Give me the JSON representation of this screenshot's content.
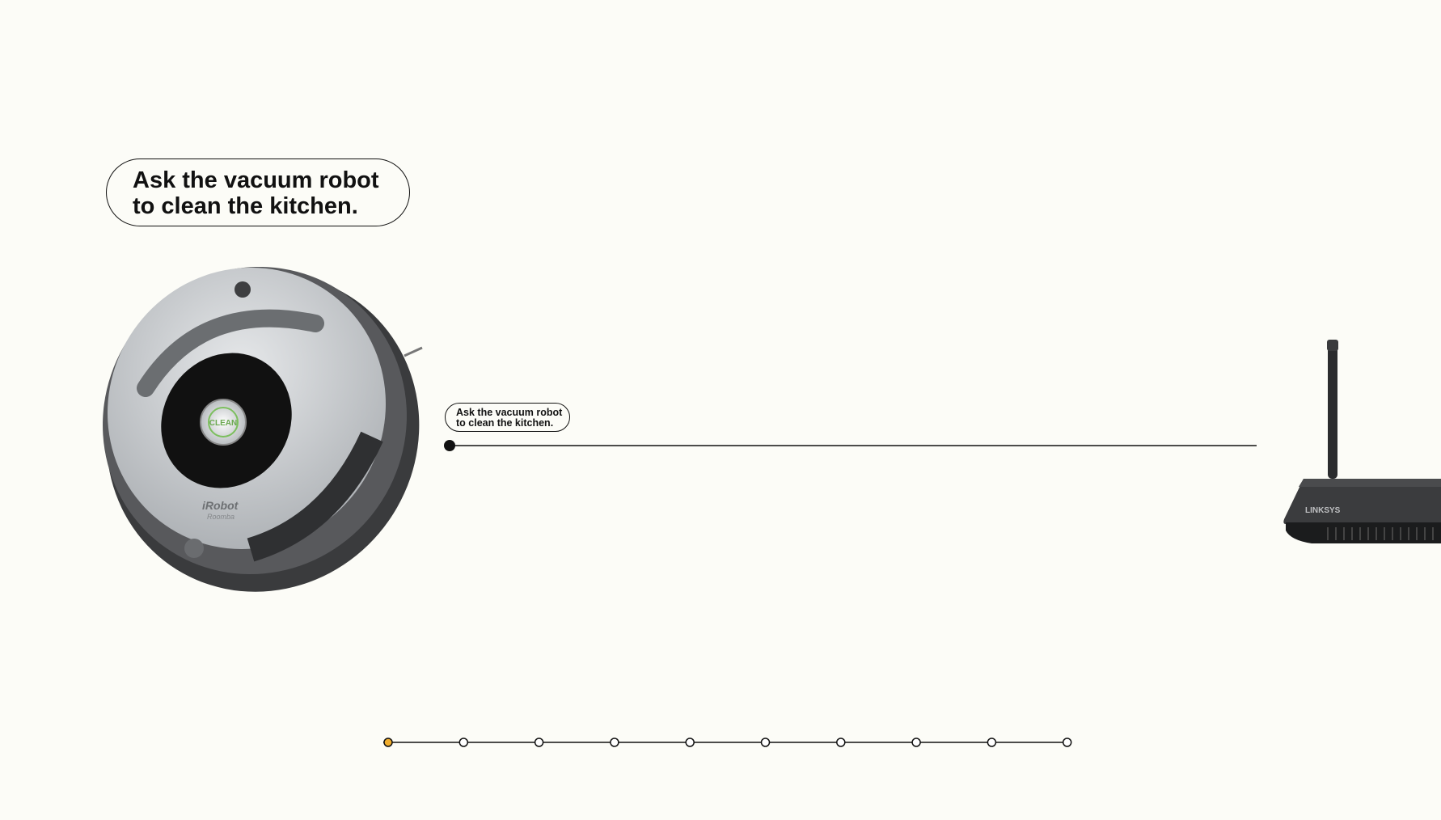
{
  "message": {
    "line1": "Ask the vacuum robot",
    "line2": "to clean the kitchen."
  },
  "robot": {
    "brand_logo": "iRobot",
    "model_logo": "Roomba",
    "button_label": "CLEAN",
    "icon": "vacuum-robot-icon"
  },
  "router": {
    "brand_logo": "LINKSYS",
    "icon": "wifi-router-icon"
  },
  "progress": {
    "total_steps": 10,
    "current_step": 1,
    "active_color": "#f0ad2d",
    "inactive_color": "#ffffff"
  },
  "colors": {
    "background": "#fcfcf7",
    "line": "#111111"
  }
}
